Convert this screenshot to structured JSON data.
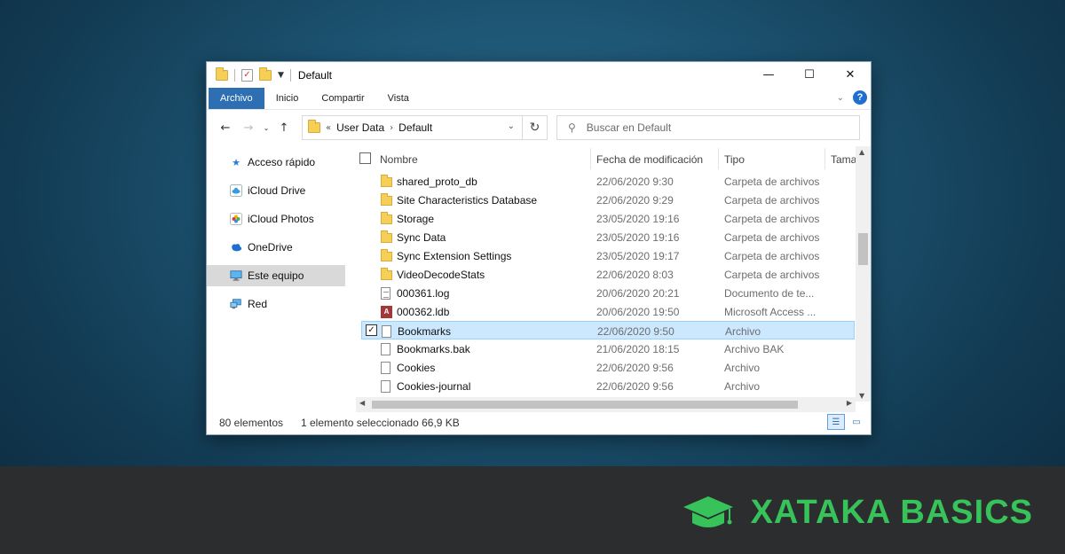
{
  "window": {
    "title": "Default",
    "controls": {
      "minimize": "—",
      "maximize": "☐",
      "close": "✕"
    }
  },
  "ribbon": {
    "tabs": [
      "Archivo",
      "Inicio",
      "Compartir",
      "Vista"
    ],
    "active_tab": "Archivo",
    "help": "?"
  },
  "navigation": {
    "breadcrumb_prefix": "«",
    "breadcrumbs": [
      "User Data",
      "Default"
    ],
    "search_placeholder": "Buscar en Default"
  },
  "sidebar": {
    "items": [
      {
        "label": "Acceso rápido",
        "icon": "star-icon",
        "selected": false
      },
      {
        "label": "iCloud Drive",
        "icon": "icloud-drive-icon",
        "selected": false
      },
      {
        "label": "iCloud Photos",
        "icon": "icloud-photos-icon",
        "selected": false
      },
      {
        "label": "OneDrive",
        "icon": "onedrive-cloud-icon",
        "selected": false
      },
      {
        "label": "Este equipo",
        "icon": "computer-icon",
        "selected": true
      },
      {
        "label": "Red",
        "icon": "network-icon",
        "selected": false
      }
    ]
  },
  "file_list": {
    "columns": [
      "Nombre",
      "Fecha de modificación",
      "Tipo",
      "Tama"
    ],
    "rows": [
      {
        "name": "shared_proto_db",
        "date": "22/06/2020 9:30",
        "type": "Carpeta de archivos",
        "icon": "folder-icon",
        "selected": false
      },
      {
        "name": "Site Characteristics Database",
        "date": "22/06/2020 9:29",
        "type": "Carpeta de archivos",
        "icon": "folder-icon",
        "selected": false
      },
      {
        "name": "Storage",
        "date": "23/05/2020 19:16",
        "type": "Carpeta de archivos",
        "icon": "folder-icon",
        "selected": false
      },
      {
        "name": "Sync Data",
        "date": "23/05/2020 19:16",
        "type": "Carpeta de archivos",
        "icon": "folder-icon",
        "selected": false
      },
      {
        "name": "Sync Extension Settings",
        "date": "23/05/2020 19:17",
        "type": "Carpeta de archivos",
        "icon": "folder-icon",
        "selected": false
      },
      {
        "name": "VideoDecodeStats",
        "date": "22/06/2020 8:03",
        "type": "Carpeta de archivos",
        "icon": "folder-icon",
        "selected": false
      },
      {
        "name": "000361.log",
        "date": "20/06/2020 20:21",
        "type": "Documento de te...",
        "icon": "text-document-icon",
        "selected": false
      },
      {
        "name": "000362.ldb",
        "date": "20/06/2020 19:50",
        "type": "Microsoft Access ...",
        "icon": "access-database-icon",
        "selected": false
      },
      {
        "name": "Bookmarks",
        "date": "22/06/2020 9:50",
        "type": "Archivo",
        "icon": "file-icon",
        "selected": true
      },
      {
        "name": "Bookmarks.bak",
        "date": "21/06/2020 18:15",
        "type": "Archivo BAK",
        "icon": "file-icon",
        "selected": false
      },
      {
        "name": "Cookies",
        "date": "22/06/2020 9:56",
        "type": "Archivo",
        "icon": "file-icon",
        "selected": false
      },
      {
        "name": "Cookies-journal",
        "date": "22/06/2020 9:56",
        "type": "Archivo",
        "icon": "file-icon",
        "selected": false
      }
    ]
  },
  "status": {
    "count": "80 elementos",
    "selection": "1 elemento seleccionado  66,9 KB"
  },
  "branding": {
    "text": "XATAKA BASICS",
    "color": "#37c25a"
  },
  "colors": {
    "ribbon_active": "#2e6fb4",
    "selection_bg": "#cce8ff",
    "folder": "#f6cf57"
  }
}
